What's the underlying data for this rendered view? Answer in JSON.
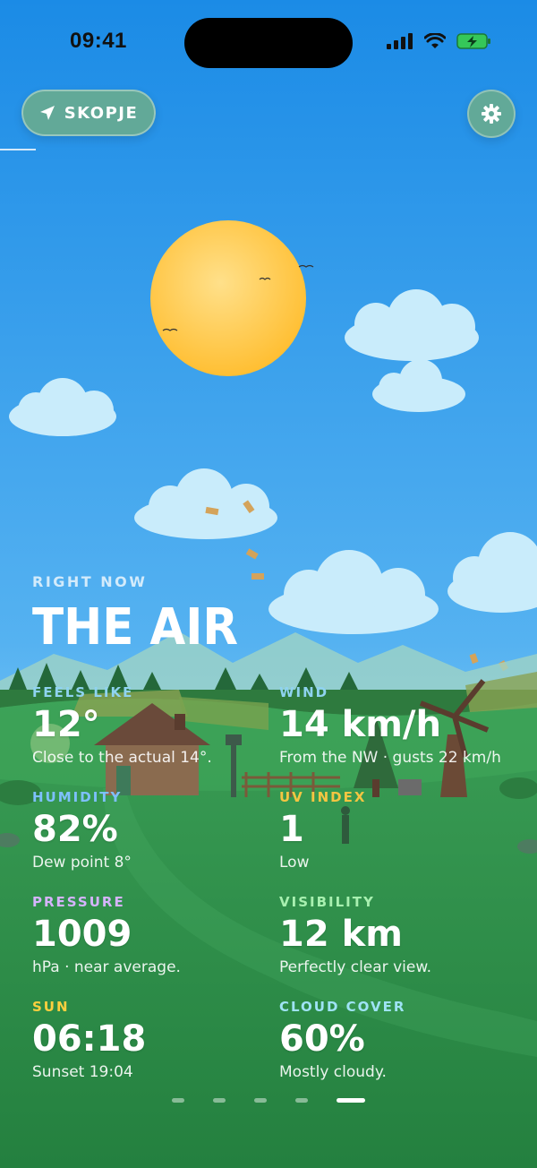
{
  "status_bar": {
    "time": "09:41"
  },
  "header": {
    "location_label": "SKOPJE"
  },
  "main": {
    "eyebrow": "RIGHT NOW",
    "title": "THE AIR",
    "metrics": [
      {
        "label": "FEELS LIKE",
        "value": "12°",
        "sub": "Close to the actual 14°.",
        "color": "#8fd3f0"
      },
      {
        "label": "WIND",
        "value": "14 km/h",
        "sub": "From the NW · gusts 22 km/h",
        "color": "#8fd3f0"
      },
      {
        "label": "HUMIDITY",
        "value": "82%",
        "sub": "Dew point 8°",
        "color": "#7ec0ff"
      },
      {
        "label": "UV INDEX",
        "value": "1",
        "sub": "Low",
        "color": "#f5c542"
      },
      {
        "label": "PRESSURE",
        "value": "1009",
        "sub": "hPa · near average.",
        "color": "#d6b4ff"
      },
      {
        "label": "VISIBILITY",
        "value": "12 km",
        "sub": "Perfectly clear view.",
        "color": "#a8f0b0"
      },
      {
        "label": "SUN",
        "value": "06:18",
        "sub": "Sunset 19:04",
        "color": "#ffcf3f"
      },
      {
        "label": "CLOUD COVER",
        "value": "60%",
        "sub": "Mostly cloudy.",
        "color": "#9fe3f5"
      }
    ]
  },
  "pager": {
    "count": 5,
    "active_index": 4
  },
  "icons": {
    "location": "location-arrow-icon",
    "settings": "gear-icon",
    "signal": "cellular-signal-icon",
    "wifi": "wifi-icon",
    "battery": "battery-charging-icon"
  },
  "colors": {
    "sky_top": "#1f8ee8",
    "sky_bottom": "#7cc4f4",
    "grass": "#2f8f4a",
    "sun": "#ffc643",
    "button_bg": "#62a998"
  }
}
